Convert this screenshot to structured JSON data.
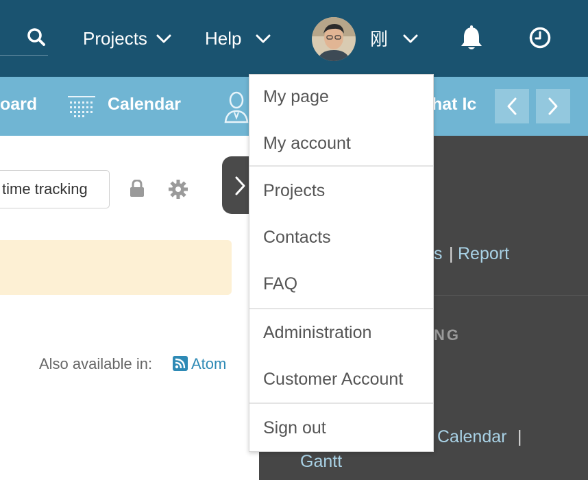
{
  "header": {
    "nav": [
      {
        "label": "Projects"
      },
      {
        "label": "Help"
      }
    ],
    "user_name": "刚"
  },
  "subnav": {
    "partial_left": "oard",
    "calendar": "Calendar",
    "partial_right": "hat Ic"
  },
  "content": {
    "time_tracking_button": "time tracking",
    "also_available_label": "Also available in:",
    "atom_link": "Atom"
  },
  "sidebar": {
    "partial_s": "s",
    "separator": "|",
    "report": "Report",
    "heading_partial": "NG",
    "calendar": "Calendar",
    "gantt": "Gantt"
  },
  "user_menu": {
    "items": [
      {
        "label": "My page"
      },
      {
        "label": "My account"
      },
      {
        "label": "Projects"
      },
      {
        "label": "Contacts"
      },
      {
        "label": "FAQ"
      },
      {
        "label": "Administration"
      },
      {
        "label": "Customer Account"
      },
      {
        "label": "Sign out"
      }
    ]
  },
  "colors": {
    "header_bg": "#1a5370",
    "subnav_bg": "#70b5d3",
    "sidebar_bg": "#464646",
    "link": "#2e8ab5",
    "notice_bg": "#fdf0d4"
  }
}
